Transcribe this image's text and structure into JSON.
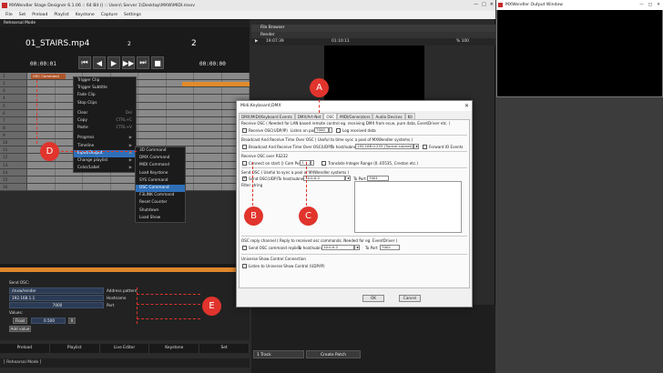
{
  "app": {
    "title": "MXWendler Stage Designer 6.1.06 :: 64 Bit () :: Users\\ Server 1\\Desktop\\MXW\\MIDI.mxsv",
    "menu": [
      "File",
      "Set",
      "Preload",
      "Playlist",
      "Keystone",
      "Capture",
      "Settings"
    ],
    "mode": "Rehearsal Mode",
    "status": "[ Rehearsal Mode ]"
  },
  "transport": {
    "clip_name": "01_STAIRS.mp4",
    "clip_index": "2",
    "clip_index_right": "2",
    "timecode_left": "00:00:01",
    "timecode_right": "00:00:00",
    "buttons": [
      "⏮",
      "◀",
      "▶",
      "▶▶",
      "⏭",
      "■"
    ]
  },
  "grid": {
    "rows": [
      "1",
      "2",
      "3",
      "4",
      "5",
      "6",
      "7",
      "8",
      "9",
      "10",
      "11",
      "12",
      "13",
      "14",
      "15",
      "16"
    ],
    "clip_label": "OSC Command"
  },
  "context_menu": {
    "items": [
      {
        "label": "Trigger Clip",
        "shortcut": ""
      },
      {
        "label": "Trigger Subtitle",
        "shortcut": ""
      },
      {
        "label": "Fade Clip",
        "shortcut": ""
      },
      {
        "label": "Stop Clips",
        "shortcut": ""
      },
      {
        "label": "Clear",
        "shortcut": "Del"
      },
      {
        "label": "Copy",
        "shortcut": "CTRL+C"
      },
      {
        "label": "Paste",
        "shortcut": "CTRL+V"
      },
      {
        "label": "Progress",
        "shortcut": "▶"
      },
      {
        "label": "Timeline",
        "shortcut": "▶"
      },
      {
        "label": "Input/Output",
        "shortcut": "▶"
      },
      {
        "label": "Change playlist",
        "shortcut": "▶"
      },
      {
        "label": "Color/Label",
        "shortcut": "▶"
      }
    ],
    "submenu": [
      "3D Command",
      "DMX Command",
      "MIDI Command",
      "Load Keystone",
      "SYS Command",
      "OSC Command",
      "F3LINK Command",
      "Reset Counter",
      "Shutdown",
      "Load Show"
    ],
    "selected_sub": "OSC Command"
  },
  "osc_panel": {
    "heading": "Send OSC:",
    "address": "/mxw/render",
    "address_label": "Address pattern",
    "host": "192.168.1.1",
    "host_label": "Hostname",
    "port": "7000",
    "port_label": "Port",
    "values_label": "Values:",
    "value_type": "Float",
    "value": "0.500",
    "remove": "X",
    "add_value": "Add value"
  },
  "tabs": [
    "Preload",
    "Playlist",
    "Live Editor",
    "Keystone",
    "Set"
  ],
  "right": {
    "file_browser": "File Browser",
    "render": "Render",
    "render_time": "19:07:39",
    "render_tc": "01:10:11",
    "render_zoom": "% 100",
    "track_button": "1 Track",
    "create_patch": "Create Patch"
  },
  "output_window": {
    "title": "MXWendler Output Window"
  },
  "dialog": {
    "title": "Midi,Keyboard,DMX",
    "tabs": [
      "DMX/MIDI/Keyboard Events",
      "DMX/Art-Net",
      "OSC",
      "MIDI/Generators",
      "Audio Devices",
      "Kit"
    ],
    "active_tab": "OSC",
    "receive_header": "Receive OSC ( Needed for LAN based remote control eg. receiving DMX from ecue, pure data, EventDriver etc. )",
    "receive_label": "Receive OSC(UDP/IP)",
    "listen_label": "Listen on port",
    "listen_port": "7000",
    "log_label": "Log received data",
    "broadcast_header": "Broadcast And Receive Time Over OSC ( Useful to time sync a pool of MXWendler systems )",
    "broadcast_label": "Broadcast And Receive Time Over OSC(UDP)",
    "to_host": "To host/subnet",
    "broadcast_ip": "192.168.0.255 (Typical subnet)",
    "forward_label": "Forward IO Events",
    "rs232_header": "Receive OSC over RS232",
    "connect_label": "Connect on start ()",
    "com_port": "Com Port",
    "com_value": "1",
    "translate_label": "Translate Integer Range (0..65535, Creston etc.)",
    "send_header": "Send OSC ( Useful to sync a pool of MXWendler systems )",
    "send_label": "Send OSC(UDP)",
    "send_ip": "10.0.0.2",
    "to_port": "To Port",
    "send_port": "7001",
    "filter_label": "Filter string",
    "reply_header": "OSC reply channel ( Reply to received osc commands. Needed for eg. EventDriver )",
    "reply_label": "Send OSC command replies",
    "reply_ip": "10.0.0.2",
    "reply_port": "7002",
    "usc_header": "Universe Show Control Connection",
    "usc_label": "Listen to Universe Show Control (UDP/IP)",
    "ok": "OK",
    "cancel": "Cancel"
  },
  "annotations": [
    "A",
    "B",
    "C",
    "D",
    "E"
  ],
  "colors": {
    "annotation": "#e0342c",
    "accent_orange": "#e0872d",
    "selection_blue": "#2f6fb8"
  }
}
